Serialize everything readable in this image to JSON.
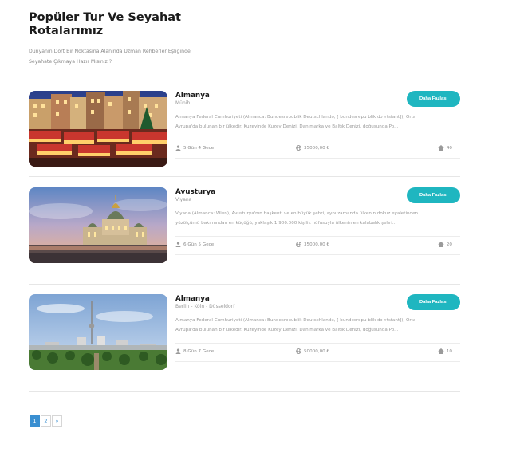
{
  "header": {
    "title_line1": "Popüler Tur Ve Seyahat",
    "title_line2": "Rotalarımız",
    "subtitle_line1": "Dünyanın Dört Bir Noktasına Alanında Uzman Rehberler Eşliğinde",
    "subtitle_line2": "Seyahate Çıkmaya Hazır Mısınız ?"
  },
  "tours": [
    {
      "name": "Almanya",
      "city": "Münih",
      "desc_line1": "Almanya Federal Cumhuriyeti (Almanca: Bundesrepublik Deutschlandə, [ bundesrepu blik dɔ ʏtsfant]), Orta",
      "desc_line2": "Avrupa'da bulunan bir ülkedir. Kuzeyinde Kuzey Denizi, Danimarka ve Baltık Denizi, doğusunda Po...",
      "button": "Daha Fazlası",
      "duration": "5 Gün 4 Gece",
      "price": "35000,00 ₺",
      "rooms": "40"
    },
    {
      "name": "Avusturya",
      "city": "Viyana",
      "desc_line1": "Viyana (Almanca: Wien), Avusturya'nın başkenti ve en büyük şehri, aynı zamanda ülkenin dokuz eyaletinden",
      "desc_line2": "yüzölçümü bakımından en küçüğü, yaklaşık 1.900.000 kişilik nüfusuyla ülkenin en kalabalık şehri...",
      "button": "Daha Fazlası",
      "duration": "6 Gün 5 Gece",
      "price": "35000,00 ₺",
      "rooms": "20"
    },
    {
      "name": "Almanya",
      "city": "Berlin - Köln - Düsseldorf",
      "desc_line1": "Almanya Federal Cumhuriyeti (Almanca: Bundesrepublik Deutschlandə, [ bundesrepu blik dɔ ʏtsfant]), Orta",
      "desc_line2": "Avrupa'da bulunan bir ülkedir. Kuzeyinde Kuzey Denizi, Danimarka ve Baltık Denizi, doğusunda Po...",
      "button": "Daha Fazlası",
      "duration": "8 Gün 7 Gece",
      "price": "50000,00 ₺",
      "rooms": "10"
    }
  ],
  "pagination": {
    "pages": [
      "1",
      "2"
    ],
    "next": "»",
    "active": "1"
  },
  "icons": {
    "duration": "user-icon",
    "price": "globe-icon",
    "rooms": "home-icon"
  },
  "colors": {
    "accent": "#1fb6c0",
    "page_active": "#3a8fd1"
  }
}
